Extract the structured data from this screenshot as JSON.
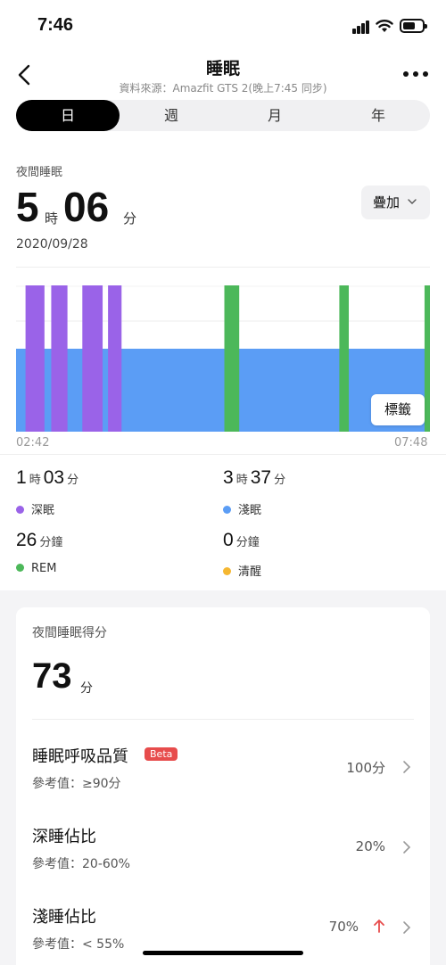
{
  "status": {
    "time": "7:46"
  },
  "nav": {
    "title": "睡眠",
    "subtitle": "資料來源：Amazfit GTS 2(晚上7:45 同步)"
  },
  "tabs": [
    {
      "label": "日"
    },
    {
      "label": "週"
    },
    {
      "label": "月"
    },
    {
      "label": "年"
    }
  ],
  "summary": {
    "label": "夜間睡眠",
    "hours": "5",
    "hours_unit": "時",
    "minutes": "06",
    "minutes_unit": "分",
    "overlay_button": "疊加",
    "date": "2020/09/28"
  },
  "chart_data": {
    "type": "area",
    "x_start": "02:42",
    "x_end": "07:48",
    "tag_button": "標籤",
    "colors": {
      "deep": "#9a63e8",
      "light": "#5b9df5",
      "rem": "#4cb85a"
    },
    "segments": [
      {
        "stage": "light",
        "start": "02:42",
        "end": "07:48"
      },
      {
        "stage": "deep",
        "start": "02:49",
        "end": "03:03"
      },
      {
        "stage": "deep",
        "start": "03:08",
        "end": "03:20"
      },
      {
        "stage": "deep",
        "start": "03:31",
        "end": "03:46"
      },
      {
        "stage": "deep",
        "start": "03:50",
        "end": "04:00"
      },
      {
        "stage": "rem",
        "start": "05:16",
        "end": "05:27"
      },
      {
        "stage": "rem",
        "start": "06:41",
        "end": "06:48"
      },
      {
        "stage": "rem",
        "start": "07:44",
        "end": "07:48"
      }
    ]
  },
  "stats": {
    "deep": {
      "h": "1",
      "hu": "時",
      "m": "03",
      "mu": "分",
      "label": "深眠",
      "color": "#9a63e8"
    },
    "light": {
      "h": "3",
      "hu": "時",
      "m": "37",
      "mu": "分",
      "label": "淺眠",
      "color": "#5b9df5"
    },
    "rem": {
      "m": "26",
      "mu": "分鐘",
      "label": "REM",
      "color": "#4cb85a"
    },
    "awake": {
      "m": "0",
      "mu": "分鐘",
      "label": "清醒",
      "color": "#f5b731"
    }
  },
  "score": {
    "title": "夜間睡眠得分",
    "value": "73",
    "unit": "分",
    "items": [
      {
        "title": "睡眠呼吸品質",
        "badge": "Beta",
        "ref": "參考值：≥90分",
        "value": "100分"
      },
      {
        "title": "深睡佔比",
        "ref": "參考值：20-60%",
        "value": "20%"
      },
      {
        "title": "淺睡佔比",
        "ref": "參考值：< 55%",
        "value": "70%",
        "trend": "up"
      }
    ]
  }
}
